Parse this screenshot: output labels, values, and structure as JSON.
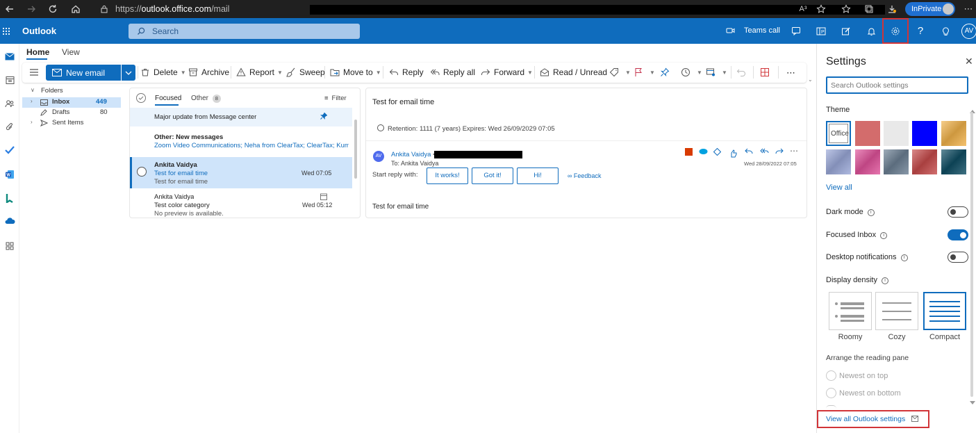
{
  "browser": {
    "url_prefix": "https://",
    "url_host": "outlook.office.com",
    "url_path": "/mail",
    "inprivate_label": "InPrivate",
    "read_aloud_label": "A³"
  },
  "header": {
    "app_name": "Outlook",
    "search_placeholder": "Search",
    "teams_call_label": "Teams call",
    "avatar_initials": "AV",
    "help_label": "?"
  },
  "ribbon": {
    "tabs": [
      "Home",
      "View"
    ],
    "new_email": "New email",
    "delete": "Delete",
    "archive": "Archive",
    "report": "Report",
    "sweep": "Sweep",
    "move_to": "Move to",
    "reply": "Reply",
    "reply_all": "Reply all",
    "forward": "Forward",
    "read_unread": "Read / Unread",
    "more": "⋯"
  },
  "folders": {
    "header": "Folders",
    "items": [
      {
        "label": "Inbox",
        "count": "449"
      },
      {
        "label": "Drafts",
        "count": "80"
      },
      {
        "label": "Sent Items",
        "count": ""
      }
    ]
  },
  "message_list": {
    "tab_focused": "Focused",
    "tab_other": "Other",
    "other_count": "8",
    "filter": "Filter",
    "pinned": {
      "subject": "Major update from Message center"
    },
    "other_banner": {
      "title": "Other: New messages",
      "senders": "Zoom Video Communications; Neha from ClearTax; ClearTax; Kum..."
    },
    "messages": [
      {
        "sender": "Ankita Vaidya",
        "subject": "Test for email time",
        "preview": "Test for email time",
        "time": "Wed 07:05"
      },
      {
        "sender": "Ankita Vaidya",
        "subject": "Test color category",
        "preview": "No preview is available.",
        "time": "Wed 05:12"
      }
    ]
  },
  "reading_pane": {
    "subject": "Test for email time",
    "retention": "Retention: 1111 (7 years) Expires: Wed 26/09/2029 07:05",
    "sender_initials": "AV",
    "sender_name": "Ankita Vaidya",
    "sender_lt": "<",
    "to_line": "To:  Ankita Vaidya",
    "date": "Wed 28/09/2022 07:05",
    "start_reply": "Start reply with:",
    "quick_replies": [
      "It works!",
      "Got it!",
      "Hi!"
    ],
    "feedback": "Feedback",
    "body": "Test for email time"
  },
  "settings": {
    "title": "Settings",
    "search_placeholder": "Search Outlook settings",
    "theme_label": "Theme",
    "office_label": "Office",
    "view_all": "View all",
    "dark_mode": {
      "label": "Dark mode",
      "on": false
    },
    "focused_inbox": {
      "label": "Focused Inbox",
      "on": true
    },
    "desktop_notifications": {
      "label": "Desktop notifications",
      "on": false
    },
    "display_density": "Display density",
    "densities": [
      "Roomy",
      "Cozy",
      "Compact"
    ],
    "selected_density": "Compact",
    "reading_pane_label": "Arrange the reading pane",
    "reading_options": [
      "Newest on top",
      "Newest on bottom"
    ],
    "view_all_settings": "View all Outlook settings",
    "theme_colors": {
      "row1": [
        "#ffffff",
        "#d36c6c",
        "#e9e9e9",
        "#0000ff",
        "#f1b24a"
      ],
      "row2": [
        "#9aa8d8",
        "#e0529a",
        "#6b7f93",
        "#c64b4b",
        "#0f4d63"
      ]
    }
  },
  "colors": {
    "brand": "#0f6cbd",
    "highlight": "#d13438"
  }
}
